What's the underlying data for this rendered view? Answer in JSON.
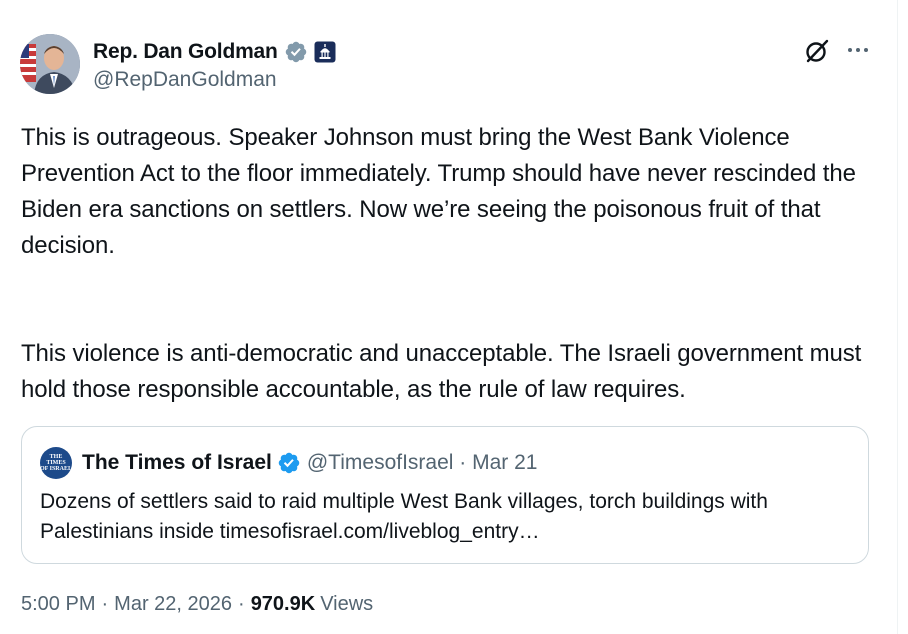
{
  "author": {
    "display_name": "Rep. Dan Goldman",
    "handle": "@RepDanGoldman",
    "verified_badge": "gray-verified-checkmark",
    "affiliation_badge": "us-capitol-government-badge"
  },
  "tweet": {
    "text_paragraph_1": "This is outrageous. Speaker Johnson must bring the West Bank Violence Prevention Act to the floor immediately.  Trump should have never rescinded the Biden era sanctions on settlers. Now we’re seeing the poisonous fruit of that decision.",
    "text_paragraph_2": "This violence is anti-democratic and unacceptable. The Israeli government must hold those responsible accountable, as the rule of law requires."
  },
  "quoted_tweet": {
    "avatar_text_line_1": "THE TIMES",
    "avatar_text_line_2": "OF ISRAEL",
    "display_name": "The Times of Israel",
    "handle": "@TimesofIsrael",
    "separator": "·",
    "date": "Mar 21",
    "text": "Dozens of settlers said to raid multiple West Bank villages, torch buildings with Palestinians inside ",
    "link_text": "timesofisrael.com/liveblog_entry…"
  },
  "meta": {
    "time": "5:00 PM",
    "separator": "·",
    "date": "Mar 22, 2026",
    "views_count": "970.9K",
    "views_label": "Views"
  },
  "colors": {
    "text_primary": "#0f1419",
    "text_secondary": "#536471",
    "border": "#cfd9de",
    "verified_blue": "#1d9bf0",
    "verified_gray": "#829aab"
  }
}
